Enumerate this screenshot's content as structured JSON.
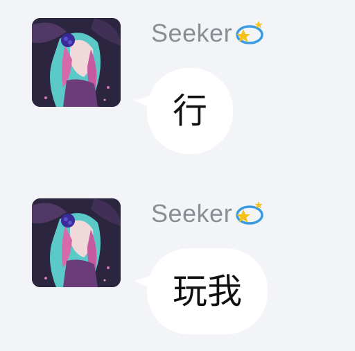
{
  "chat": {
    "messages": [
      {
        "sender": "Seeker",
        "badge_icon": "star-orbit-icon",
        "text": "行"
      },
      {
        "sender": "Seeker",
        "badge_icon": "star-orbit-icon",
        "text": "玩我"
      }
    ]
  },
  "colors": {
    "background": "#f2f4f7",
    "bubble": "#ffffff",
    "username": "#8a8d93",
    "message_text": "#111111"
  }
}
